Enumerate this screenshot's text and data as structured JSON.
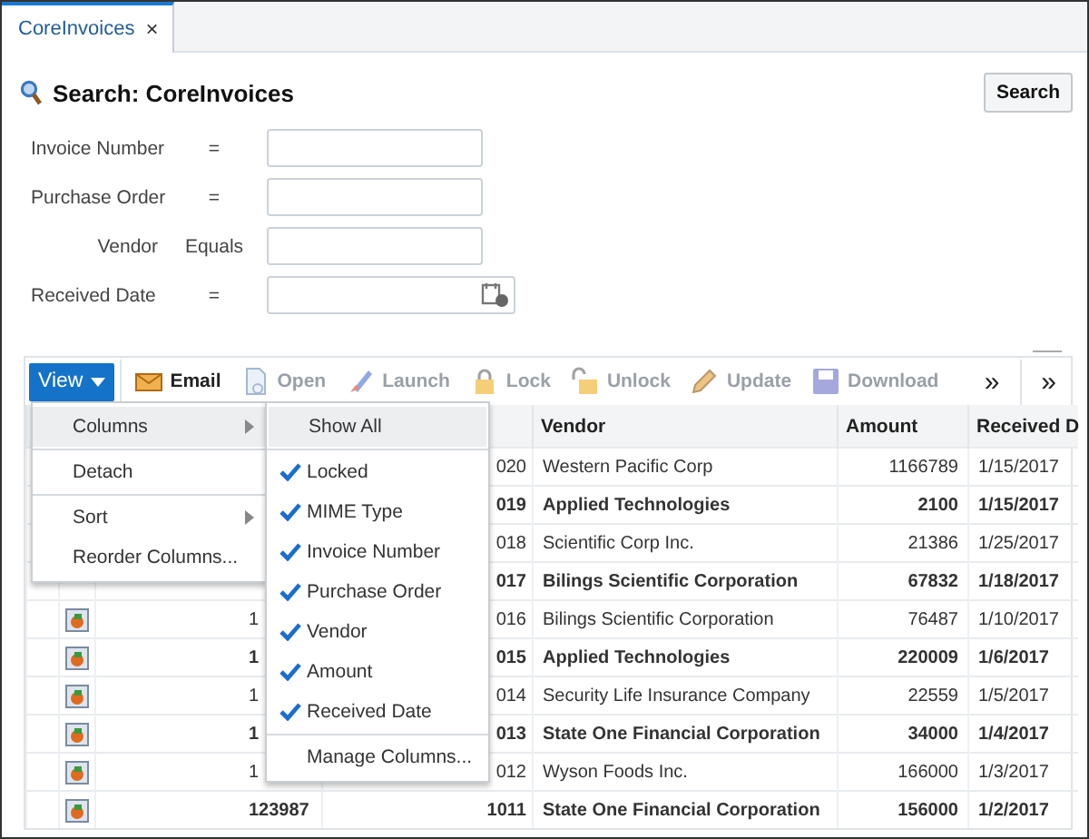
{
  "tabs": [
    {
      "label": "CoreInvoices",
      "selected": true,
      "close": "×"
    }
  ],
  "search": {
    "title": "Search: CoreInvoices",
    "button": "Search",
    "fields": [
      {
        "label": "Invoice Number",
        "operator": "=",
        "kind": "text"
      },
      {
        "label": "Purchase Order",
        "operator": "=",
        "kind": "text"
      },
      {
        "label": "Vendor",
        "operator": "Equals",
        "kind": "text"
      },
      {
        "label": "Received Date",
        "operator": "=",
        "kind": "date"
      }
    ]
  },
  "toolbar": {
    "view": "View",
    "items": [
      {
        "label": "Email",
        "kind": "email",
        "disabled": false
      },
      {
        "label": "Open",
        "kind": "open",
        "disabled": true
      },
      {
        "label": "Launch",
        "kind": "launch",
        "disabled": true
      },
      {
        "label": "Lock",
        "kind": "lock",
        "disabled": true
      },
      {
        "label": "Unlock",
        "kind": "unlock",
        "disabled": true
      },
      {
        "label": "Update",
        "kind": "update",
        "disabled": true
      },
      {
        "label": "Download",
        "kind": "download",
        "disabled": true
      }
    ],
    "overflow": [
      "»",
      "»"
    ]
  },
  "table": {
    "columns": [
      "Vendor",
      "Amount",
      "Received D"
    ],
    "rows": [
      {
        "has_icon": false,
        "column_2": "",
        "column_3": "020",
        "vendor": "Western Pacific Corp",
        "amount": "1166789",
        "date": "1/15/2017",
        "bold": false
      },
      {
        "has_icon": false,
        "column_2": "",
        "column_3": "019",
        "vendor": "Applied Technologies",
        "amount": "2100",
        "date": "1/15/2017",
        "bold": true
      },
      {
        "has_icon": false,
        "column_2": "",
        "column_3": "018",
        "vendor": "Scientific Corp Inc.",
        "amount": "21386",
        "date": "1/25/2017",
        "bold": false
      },
      {
        "has_icon": false,
        "column_2": "",
        "column_3": "017",
        "vendor": "Bilings Scientific Corporation",
        "amount": "67832",
        "date": "1/18/2017",
        "bold": true
      },
      {
        "has_icon": true,
        "column_2": "1",
        "column_3": "016",
        "vendor": "Bilings Scientific Corporation",
        "amount": "76487",
        "date": "1/10/2017",
        "bold": false
      },
      {
        "has_icon": true,
        "column_2": "1",
        "column_3": "015",
        "vendor": "Applied Technologies",
        "amount": "220009",
        "date": "1/6/2017",
        "bold": true
      },
      {
        "has_icon": true,
        "column_2": "1",
        "column_3": "014",
        "vendor": "Security Life Insurance Company",
        "amount": "22559",
        "date": "1/5/2017",
        "bold": false
      },
      {
        "has_icon": true,
        "column_2": "1",
        "column_3": "013",
        "vendor": "State One Financial Corporation",
        "amount": "34000",
        "date": "1/4/2017",
        "bold": true
      },
      {
        "has_icon": true,
        "column_2": "1",
        "column_3": "012",
        "vendor": "Wyson Foods Inc.",
        "amount": "166000",
        "date": "1/3/2017",
        "bold": false
      },
      {
        "has_icon": true,
        "column_2": "123987",
        "column_3": "1011",
        "vendor": "State One Financial Corporation",
        "amount": "156000",
        "date": "1/2/2017",
        "bold": true
      }
    ]
  },
  "view_menu": {
    "items": [
      {
        "label": "Columns",
        "submenu": true,
        "selected": true
      },
      {
        "label": "Detach",
        "submenu": false,
        "selected": false
      },
      {
        "label": "Sort",
        "submenu": true,
        "selected": false
      },
      {
        "label": "Reorder Columns...",
        "submenu": false,
        "selected": false
      }
    ]
  },
  "columns_menu": {
    "show_all": {
      "label": "Show All",
      "selected": true
    },
    "items": [
      {
        "label": "Locked",
        "checked": true,
        "selected": false
      },
      {
        "label": "MIME Type",
        "checked": true,
        "selected": false
      },
      {
        "label": "Invoice Number",
        "checked": true,
        "selected": false
      },
      {
        "label": "Purchase Order",
        "checked": true,
        "selected": false
      },
      {
        "label": "Vendor",
        "checked": true,
        "selected": false
      },
      {
        "label": "Amount",
        "checked": true,
        "selected": false
      },
      {
        "label": "Received Date",
        "checked": true,
        "selected": false
      }
    ],
    "manage": {
      "label": "Manage Columns...",
      "selected": false
    }
  }
}
